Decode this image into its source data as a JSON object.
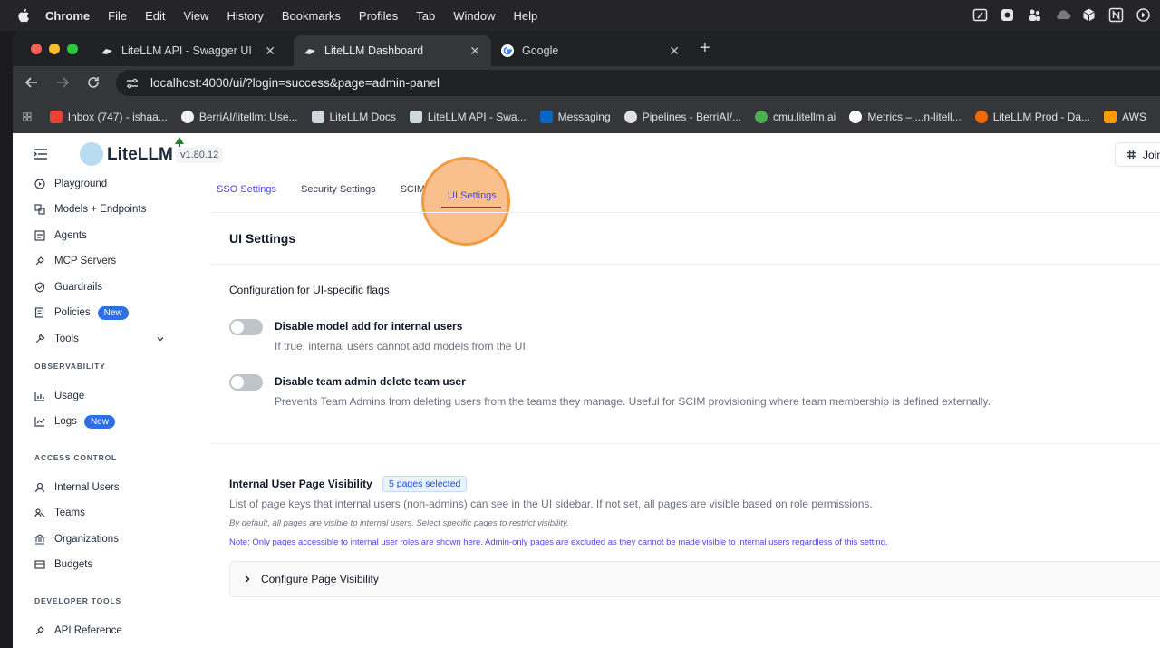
{
  "menubar": {
    "items": [
      "Chrome",
      "File",
      "Edit",
      "View",
      "History",
      "Bookmarks",
      "Profiles",
      "Tab",
      "Window",
      "Help"
    ]
  },
  "browser": {
    "tabs": [
      {
        "title": "LiteLLM API - Swagger UI",
        "icon": "litellm-favicon"
      },
      {
        "title": "LiteLLM Dashboard",
        "icon": "litellm-favicon"
      },
      {
        "title": "Google",
        "icon": "google-favicon"
      }
    ],
    "url": "localhost:4000/ui/?login=success&page=admin-panel",
    "bookmarks": [
      {
        "label": "Inbox (747) - ishaa...",
        "icon": "gmail-icon"
      },
      {
        "label": "BerriAI/litellm: Use...",
        "icon": "github-icon"
      },
      {
        "label": "LiteLLM Docs",
        "icon": "litellm-icon"
      },
      {
        "label": "LiteLLM API - Swa...",
        "icon": "litellm-icon"
      },
      {
        "label": "Messaging",
        "icon": "linkedin-icon"
      },
      {
        "label": "Pipelines - BerriAI/...",
        "icon": "pipelines-icon"
      },
      {
        "label": "cmu.litellm.ai",
        "icon": "cmu-icon"
      },
      {
        "label": "Metrics – ...n-litell...",
        "icon": "google-icon"
      },
      {
        "label": "LiteLLM Prod - Da...",
        "icon": "grafana-icon"
      },
      {
        "label": "AWS",
        "icon": "aws-icon"
      }
    ]
  },
  "header": {
    "brand": "LiteLLM",
    "version": "v1.80.12",
    "join_label": "Join"
  },
  "sidebar": {
    "items": [
      {
        "label": "Playground",
        "icon": "play-circle-icon"
      },
      {
        "label": "Models + Endpoints",
        "icon": "models-icon"
      },
      {
        "label": "Agents",
        "icon": "agents-icon"
      },
      {
        "label": "MCP Servers",
        "icon": "mcp-icon"
      },
      {
        "label": "Guardrails",
        "icon": "shield-icon"
      },
      {
        "label": "Policies",
        "icon": "policies-icon",
        "badge": "New"
      },
      {
        "label": "Tools",
        "icon": "wrench-icon"
      }
    ],
    "observability_label": "OBSERVABILITY",
    "observability_items": [
      {
        "label": "Usage",
        "icon": "bar-chart-icon"
      },
      {
        "label": "Logs",
        "icon": "line-chart-icon",
        "badge": "New"
      }
    ],
    "access_label": "ACCESS CONTROL",
    "access_items": [
      {
        "label": "Internal Users",
        "icon": "user-icon"
      },
      {
        "label": "Teams",
        "icon": "teams-icon"
      },
      {
        "label": "Organizations",
        "icon": "bank-icon"
      },
      {
        "label": "Budgets",
        "icon": "wallet-icon"
      }
    ],
    "devtools_label": "DEVELOPER TOOLS",
    "devtools_items": [
      {
        "label": "API Reference",
        "icon": "api-icon"
      }
    ]
  },
  "settings_tabs": [
    "SSO Settings",
    "Security Settings",
    "SCIM",
    "UI Settings"
  ],
  "ui_settings": {
    "title": "UI Settings",
    "config_label": "Configuration for UI-specific flags",
    "options": [
      {
        "title": "Disable model add for internal users",
        "desc": "If true, internal users cannot add models from the UI",
        "enabled": false
      },
      {
        "title": "Disable team admin delete team user",
        "desc": "Prevents Team Admins from deleting users from the teams they manage. Useful for SCIM provisioning where team membership is defined externally.",
        "enabled": false
      }
    ],
    "visibility": {
      "title": "Internal User Page Visibility",
      "badge": "5 pages selected",
      "desc": "List of page keys that internal users (non-admins) can see in the UI sidebar. If not set, all pages are visible based on role permissions.",
      "hint": "By default, all pages are visible to internal users. Select specific pages to restrict visibility.",
      "note": "Note: Only pages accessible to internal user roles are shown here. Admin-only pages are excluded as they cannot be made visible to internal users regardless of this setting.",
      "accordion_label": "Configure Page Visibility"
    }
  },
  "colors": {
    "accent": "#4f46e5",
    "badge_blue": "#2f6fe4",
    "highlight": "#f09a43"
  }
}
